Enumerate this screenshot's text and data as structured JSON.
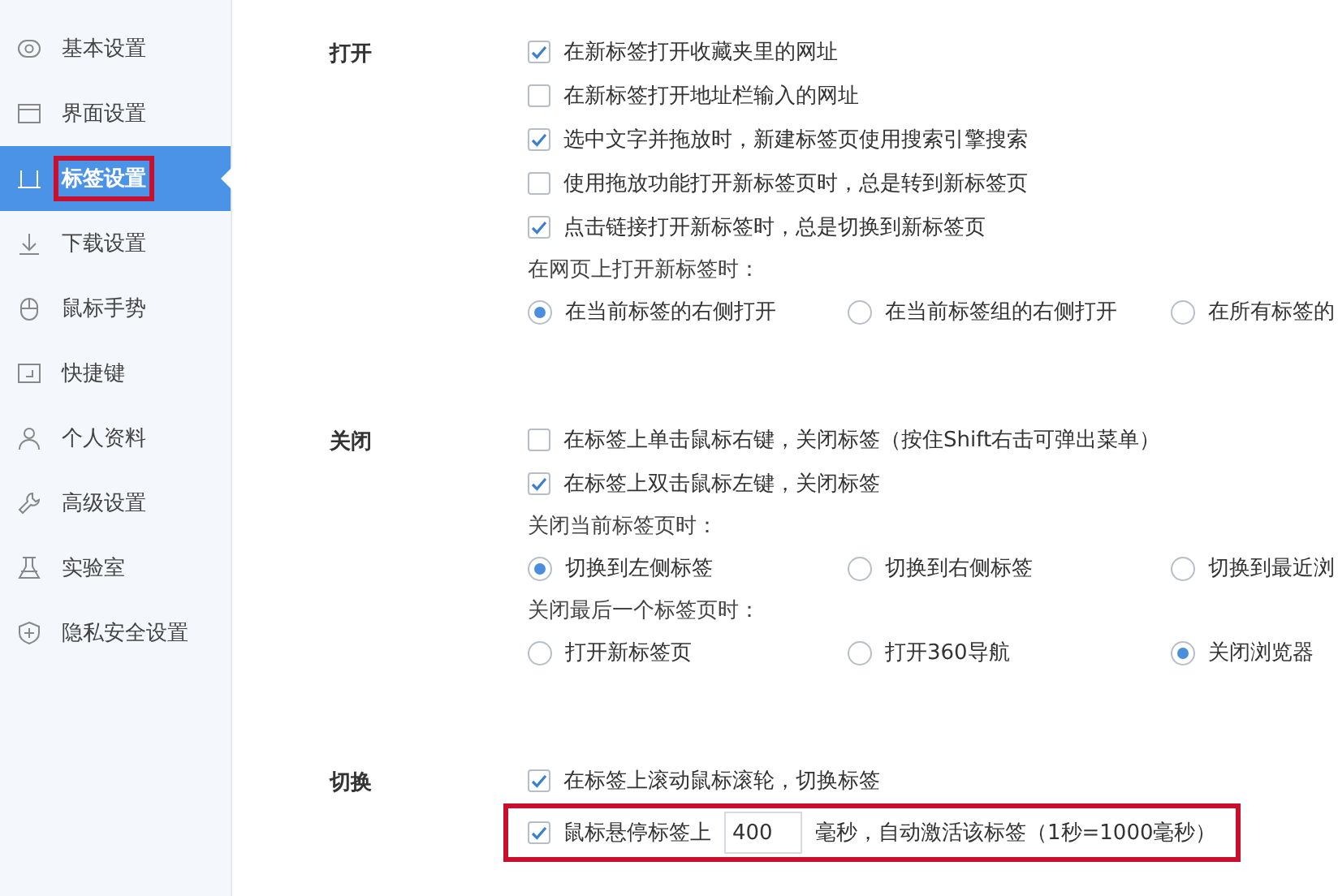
{
  "sidebar": {
    "items": [
      {
        "label": "基本设置",
        "selected": false,
        "highlighted": false
      },
      {
        "label": "界面设置",
        "selected": false,
        "highlighted": false
      },
      {
        "label": "标签设置",
        "selected": true,
        "highlighted": true
      },
      {
        "label": "下载设置",
        "selected": false,
        "highlighted": false
      },
      {
        "label": "鼠标手势",
        "selected": false,
        "highlighted": false
      },
      {
        "label": "快捷键",
        "selected": false,
        "highlighted": false
      },
      {
        "label": "个人资料",
        "selected": false,
        "highlighted": false
      },
      {
        "label": "高级设置",
        "selected": false,
        "highlighted": false
      },
      {
        "label": "实验室",
        "selected": false,
        "highlighted": false
      },
      {
        "label": "隐私安全设置",
        "selected": false,
        "highlighted": false
      }
    ]
  },
  "sections": [
    {
      "title": "打开",
      "items": [
        {
          "kind": "checkbox",
          "label": "在新标签打开收藏夹里的网址",
          "checked": true
        },
        {
          "kind": "checkbox",
          "label": "在新标签打开地址栏输入的网址",
          "checked": false
        },
        {
          "kind": "checkbox",
          "label": "选中文字并拖放时，新建标签页使用搜索引擎搜索",
          "checked": true
        },
        {
          "kind": "checkbox",
          "label": "使用拖放功能打开新标签页时，总是转到新标签页",
          "checked": false
        },
        {
          "kind": "checkbox",
          "label": "点击链接打开新标签时，总是切换到新标签页",
          "checked": true
        },
        {
          "kind": "prompt",
          "label": "在网页上打开新标签时："
        },
        {
          "kind": "radios",
          "options": [
            {
              "label": "在当前标签的右侧打开",
              "selected": true
            },
            {
              "label": "在当前标签组的右侧打开",
              "selected": false
            },
            {
              "label": "在所有标签的",
              "selected": false
            }
          ]
        }
      ]
    },
    {
      "title": "关闭",
      "items": [
        {
          "kind": "checkbox",
          "label": "在标签上单击鼠标右键，关闭标签（按住Shift右击可弹出菜单）",
          "checked": false
        },
        {
          "kind": "checkbox",
          "label": "在标签上双击鼠标左键，关闭标签",
          "checked": true
        },
        {
          "kind": "prompt",
          "label": "关闭当前标签页时："
        },
        {
          "kind": "radios",
          "options": [
            {
              "label": "切换到左侧标签",
              "selected": true
            },
            {
              "label": "切换到右侧标签",
              "selected": false
            },
            {
              "label": "切换到最近浏",
              "selected": false
            }
          ]
        },
        {
          "kind": "prompt",
          "label": "关闭最后一个标签页时："
        },
        {
          "kind": "radios",
          "options": [
            {
              "label": "打开新标签页",
              "selected": false
            },
            {
              "label": "打开360导航",
              "selected": false
            },
            {
              "label": "关闭浏览器",
              "selected": true
            }
          ]
        }
      ]
    },
    {
      "title": "切换",
      "items": [
        {
          "kind": "checkbox",
          "label": "在标签上滚动鼠标滚轮，切换标签",
          "checked": true
        },
        {
          "kind": "delay",
          "checked": true,
          "before": "鼠标悬停标签上",
          "value": "400",
          "after": "毫秒，自动激活该标签（1秒=1000毫秒）",
          "highlighted": true
        }
      ]
    }
  ]
}
